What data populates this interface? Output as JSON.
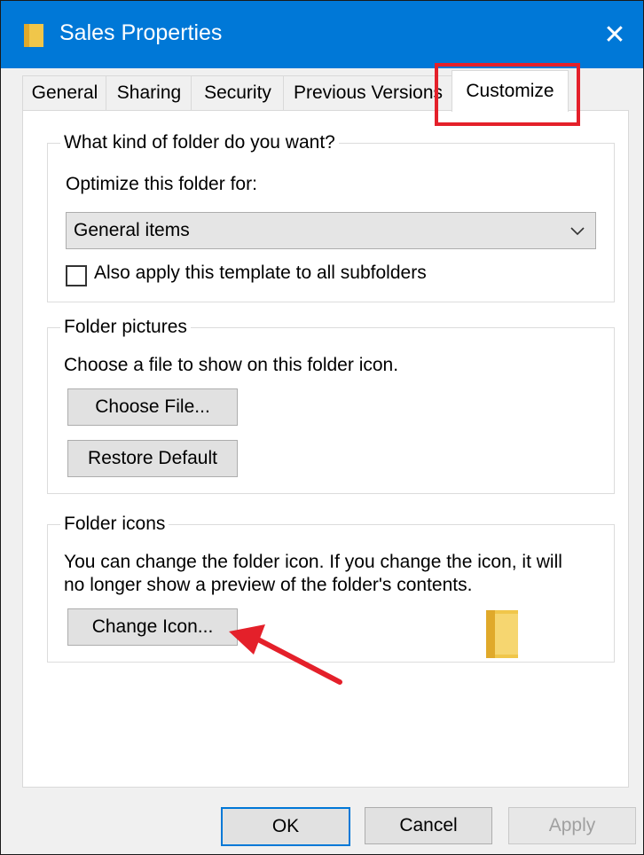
{
  "window": {
    "title": "Sales Properties",
    "icon": "folder-icon",
    "close_glyph": "✕"
  },
  "tabs": [
    {
      "label": "General",
      "active": false
    },
    {
      "label": "Sharing",
      "active": false
    },
    {
      "label": "Security",
      "active": false
    },
    {
      "label": "Previous Versions",
      "active": false
    },
    {
      "label": "Customize",
      "active": true
    }
  ],
  "folder_type": {
    "group_title": "What kind of folder do you want?",
    "optimize_label": "Optimize this folder for:",
    "select_value": "General items",
    "apply_all_label": "Also apply this template to all subfolders",
    "apply_all_checked": false
  },
  "folder_pictures": {
    "group_title": "Folder pictures",
    "description": "Choose a file to show on this folder icon.",
    "choose_file_label": "Choose File...",
    "restore_default_label": "Restore Default"
  },
  "folder_icons": {
    "group_title": "Folder icons",
    "description_line1": "You can change the folder icon. If you change the icon, it will",
    "description_line2": "no longer show a preview of the folder's contents.",
    "change_icon_label": "Change Icon...",
    "preview_icon": "folder-icon"
  },
  "footer": {
    "ok_label": "OK",
    "cancel_label": "Cancel",
    "apply_label": "Apply"
  },
  "colors": {
    "titlebar": "#0078d7",
    "highlight": "#e4202a",
    "folder": "#f0c64a"
  }
}
